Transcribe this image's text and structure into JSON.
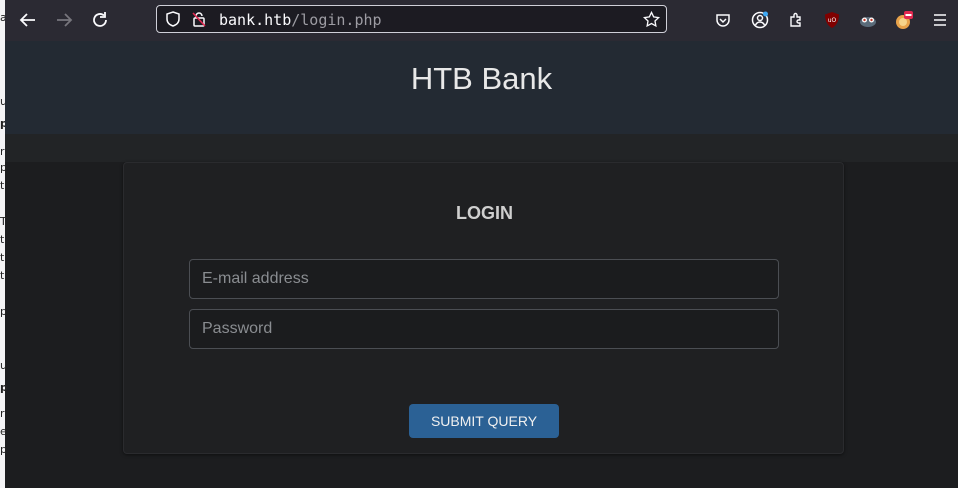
{
  "browser": {
    "url_host": "bank.htb",
    "url_path": "/login.php"
  },
  "page": {
    "brand": "HTB Bank",
    "login_title": "LOGIN",
    "email_placeholder": "E-mail address",
    "password_placeholder": "Password",
    "submit_label": "SUBMIT QUERY"
  },
  "icons": {
    "back": "back-arrow-icon",
    "forward": "forward-arrow-icon",
    "reload": "reload-icon",
    "shield": "tracking-protection-icon",
    "site": "site-permissions-icon",
    "bookmark": "bookmark-star-icon",
    "pocket": "pocket-icon",
    "account": "account-icon",
    "extensions": "extensions-icon",
    "ublock": "ublock-origin-icon",
    "ext2": "extension-icon",
    "ext3": "extension-icon",
    "menu": "hamburger-menu-icon"
  },
  "colors": {
    "header_bg": "#232a33",
    "button_bg": "#2b6195",
    "toolbar_bg": "#2b2a33"
  }
}
